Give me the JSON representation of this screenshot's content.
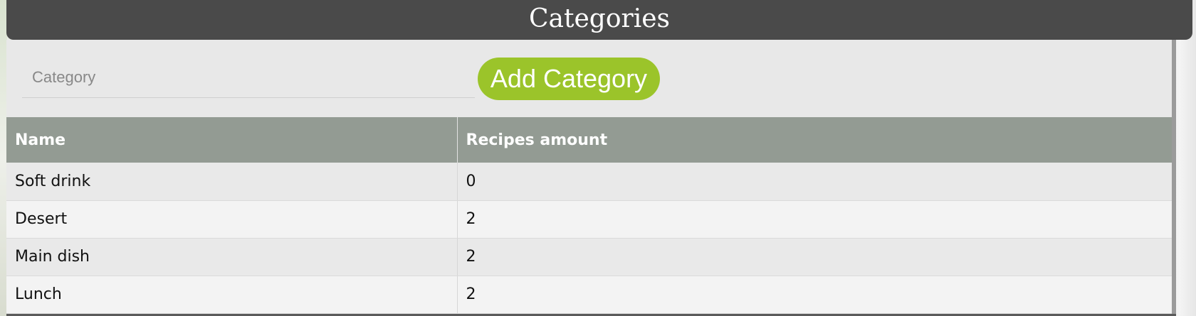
{
  "header": {
    "title": "Categories"
  },
  "add_form": {
    "category_placeholder": "Category",
    "category_value": "",
    "add_button_label": "Add Category"
  },
  "table": {
    "columns": [
      "Name",
      "Recipes amount"
    ],
    "rows": [
      {
        "name": "Soft drink",
        "recipes_amount": "0"
      },
      {
        "name": "Desert",
        "recipes_amount": "2"
      },
      {
        "name": "Main dish",
        "recipes_amount": "2"
      },
      {
        "name": "Lunch",
        "recipes_amount": "2"
      }
    ]
  },
  "colors": {
    "header_bg": "#4a4a4a",
    "accent": "#9bc42a",
    "table_header_bg": "#939b93"
  }
}
